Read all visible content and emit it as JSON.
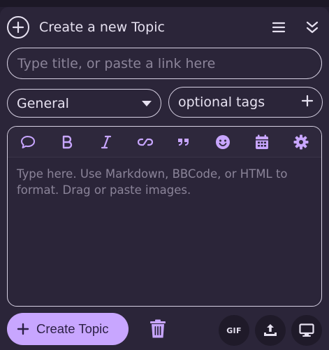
{
  "header": {
    "title": "Create a new Topic",
    "add_icon": "circle-plus-icon",
    "menu_icon": "hamburger-icon",
    "collapse_icon": "double-chevron-down-icon"
  },
  "title_field": {
    "value": "",
    "placeholder": "Type title, or paste a link here"
  },
  "category": {
    "selected": "General",
    "icon": "caret-down-icon"
  },
  "tags": {
    "placeholder": "optional tags",
    "icon": "plus-icon"
  },
  "editor": {
    "toolbar": [
      {
        "name": "speech-bubble-icon"
      },
      {
        "name": "bold-icon"
      },
      {
        "name": "italic-icon"
      },
      {
        "name": "link-icon"
      },
      {
        "name": "quote-icon"
      },
      {
        "name": "emoji-icon"
      },
      {
        "name": "calendar-icon"
      },
      {
        "name": "gear-icon"
      }
    ],
    "placeholder": "Type here. Use Markdown, BBCode, or HTML to format. Drag or paste images."
  },
  "footer": {
    "create_label": "Create Topic",
    "gif_label": "GIF",
    "trash_icon": "trash-icon",
    "upload_icon": "upload-icon",
    "preview_icon": "monitor-icon"
  },
  "colors": {
    "background": "#2b2539",
    "accent": "#c8a6ff",
    "text": "#e6e1f0",
    "placeholder": "#8b8499",
    "border": "#d6d0e2"
  }
}
